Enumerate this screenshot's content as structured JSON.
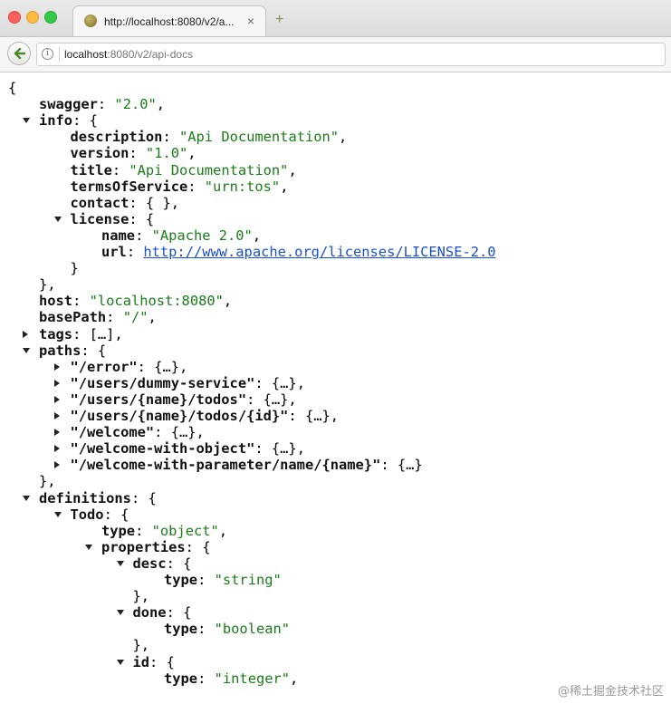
{
  "browser": {
    "tab_title": "http://localhost:8080/v2/a...",
    "tab_close": "×",
    "new_tab": "+",
    "url_host": "localhost",
    "url_rest": ":8080/v2/api-docs"
  },
  "json_lines": [
    {
      "i": 0,
      "t": "none",
      "p": [
        [
          "p",
          "{"
        ]
      ]
    },
    {
      "i": 1,
      "t": "none",
      "p": [
        [
          "k",
          "swagger"
        ],
        [
          "p",
          ": "
        ],
        [
          "s",
          "\"2.0\""
        ],
        [
          "p",
          ","
        ]
      ]
    },
    {
      "i": 1,
      "t": "open",
      "p": [
        [
          "k",
          "info"
        ],
        [
          "p",
          ": {"
        ]
      ]
    },
    {
      "i": 2,
      "t": "none",
      "p": [
        [
          "k",
          "description"
        ],
        [
          "p",
          ": "
        ],
        [
          "s",
          "\"Api Documentation\""
        ],
        [
          "p",
          ","
        ]
      ]
    },
    {
      "i": 2,
      "t": "none",
      "p": [
        [
          "k",
          "version"
        ],
        [
          "p",
          ": "
        ],
        [
          "s",
          "\"1.0\""
        ],
        [
          "p",
          ","
        ]
      ]
    },
    {
      "i": 2,
      "t": "none",
      "p": [
        [
          "k",
          "title"
        ],
        [
          "p",
          ": "
        ],
        [
          "s",
          "\"Api Documentation\""
        ],
        [
          "p",
          ","
        ]
      ]
    },
    {
      "i": 2,
      "t": "none",
      "p": [
        [
          "k",
          "termsOfService"
        ],
        [
          "p",
          ": "
        ],
        [
          "s",
          "\"urn:tos\""
        ],
        [
          "p",
          ","
        ]
      ]
    },
    {
      "i": 2,
      "t": "none",
      "p": [
        [
          "k",
          "contact"
        ],
        [
          "p",
          ": { },"
        ]
      ]
    },
    {
      "i": 2,
      "t": "open",
      "p": [
        [
          "k",
          "license"
        ],
        [
          "p",
          ": {"
        ]
      ]
    },
    {
      "i": 3,
      "t": "none",
      "p": [
        [
          "k",
          "name"
        ],
        [
          "p",
          ": "
        ],
        [
          "s",
          "\"Apache 2.0\""
        ],
        [
          "p",
          ","
        ]
      ]
    },
    {
      "i": 3,
      "t": "none",
      "p": [
        [
          "k",
          "url"
        ],
        [
          "p",
          ": "
        ],
        [
          "l",
          "http://www.apache.org/licenses/LICENSE-2.0"
        ]
      ]
    },
    {
      "i": 2,
      "t": "none",
      "p": [
        [
          "p",
          "}"
        ]
      ]
    },
    {
      "i": 1,
      "t": "none",
      "p": [
        [
          "p",
          "},"
        ]
      ]
    },
    {
      "i": 1,
      "t": "none",
      "p": [
        [
          "k",
          "host"
        ],
        [
          "p",
          ": "
        ],
        [
          "s",
          "\"localhost:8080\""
        ],
        [
          "p",
          ","
        ]
      ]
    },
    {
      "i": 1,
      "t": "none",
      "p": [
        [
          "k",
          "basePath"
        ],
        [
          "p",
          ": "
        ],
        [
          "s",
          "\"/\""
        ],
        [
          "p",
          ","
        ]
      ]
    },
    {
      "i": 1,
      "t": "closed",
      "p": [
        [
          "k",
          "tags"
        ],
        [
          "p",
          ": […],"
        ]
      ]
    },
    {
      "i": 1,
      "t": "open",
      "p": [
        [
          "k",
          "paths"
        ],
        [
          "p",
          ": {"
        ]
      ]
    },
    {
      "i": 2,
      "t": "closed",
      "p": [
        [
          "k",
          "\"/error\""
        ],
        [
          "p",
          ": {…},"
        ]
      ]
    },
    {
      "i": 2,
      "t": "closed",
      "p": [
        [
          "k",
          "\"/users/dummy-service\""
        ],
        [
          "p",
          ": {…},"
        ]
      ]
    },
    {
      "i": 2,
      "t": "closed",
      "p": [
        [
          "k",
          "\"/users/{name}/todos\""
        ],
        [
          "p",
          ": {…},"
        ]
      ]
    },
    {
      "i": 2,
      "t": "closed",
      "p": [
        [
          "k",
          "\"/users/{name}/todos/{id}\""
        ],
        [
          "p",
          ": {…},"
        ]
      ]
    },
    {
      "i": 2,
      "t": "closed",
      "p": [
        [
          "k",
          "\"/welcome\""
        ],
        [
          "p",
          ": {…},"
        ]
      ]
    },
    {
      "i": 2,
      "t": "closed",
      "p": [
        [
          "k",
          "\"/welcome-with-object\""
        ],
        [
          "p",
          ": {…},"
        ]
      ]
    },
    {
      "i": 2,
      "t": "closed",
      "p": [
        [
          "k",
          "\"/welcome-with-parameter/name/{name}\""
        ],
        [
          "p",
          ": {…}"
        ]
      ]
    },
    {
      "i": 1,
      "t": "none",
      "p": [
        [
          "p",
          "},"
        ]
      ]
    },
    {
      "i": 1,
      "t": "open",
      "p": [
        [
          "k",
          "definitions"
        ],
        [
          "p",
          ": {"
        ]
      ]
    },
    {
      "i": 2,
      "t": "open",
      "p": [
        [
          "k",
          "Todo"
        ],
        [
          "p",
          ": {"
        ]
      ]
    },
    {
      "i": 3,
      "t": "none",
      "p": [
        [
          "k",
          "type"
        ],
        [
          "p",
          ": "
        ],
        [
          "s",
          "\"object\""
        ],
        [
          "p",
          ","
        ]
      ]
    },
    {
      "i": 3,
      "t": "open",
      "p": [
        [
          "k",
          "properties"
        ],
        [
          "p",
          ": {"
        ]
      ]
    },
    {
      "i": 4,
      "t": "open",
      "p": [
        [
          "k",
          "desc"
        ],
        [
          "p",
          ": {"
        ]
      ]
    },
    {
      "i": 5,
      "t": "none",
      "p": [
        [
          "k",
          "type"
        ],
        [
          "p",
          ": "
        ],
        [
          "s",
          "\"string\""
        ]
      ]
    },
    {
      "i": 4,
      "t": "none",
      "p": [
        [
          "p",
          "},"
        ]
      ]
    },
    {
      "i": 4,
      "t": "open",
      "p": [
        [
          "k",
          "done"
        ],
        [
          "p",
          ": {"
        ]
      ]
    },
    {
      "i": 5,
      "t": "none",
      "p": [
        [
          "k",
          "type"
        ],
        [
          "p",
          ": "
        ],
        [
          "s",
          "\"boolean\""
        ]
      ]
    },
    {
      "i": 4,
      "t": "none",
      "p": [
        [
          "p",
          "},"
        ]
      ]
    },
    {
      "i": 4,
      "t": "open",
      "p": [
        [
          "k",
          "id"
        ],
        [
          "p",
          ": {"
        ]
      ]
    },
    {
      "i": 5,
      "t": "none",
      "p": [
        [
          "k",
          "type"
        ],
        [
          "p",
          ": "
        ],
        [
          "s",
          "\"integer\""
        ],
        [
          "p",
          ","
        ]
      ]
    }
  ],
  "watermark": "@稀土掘金技术社区"
}
